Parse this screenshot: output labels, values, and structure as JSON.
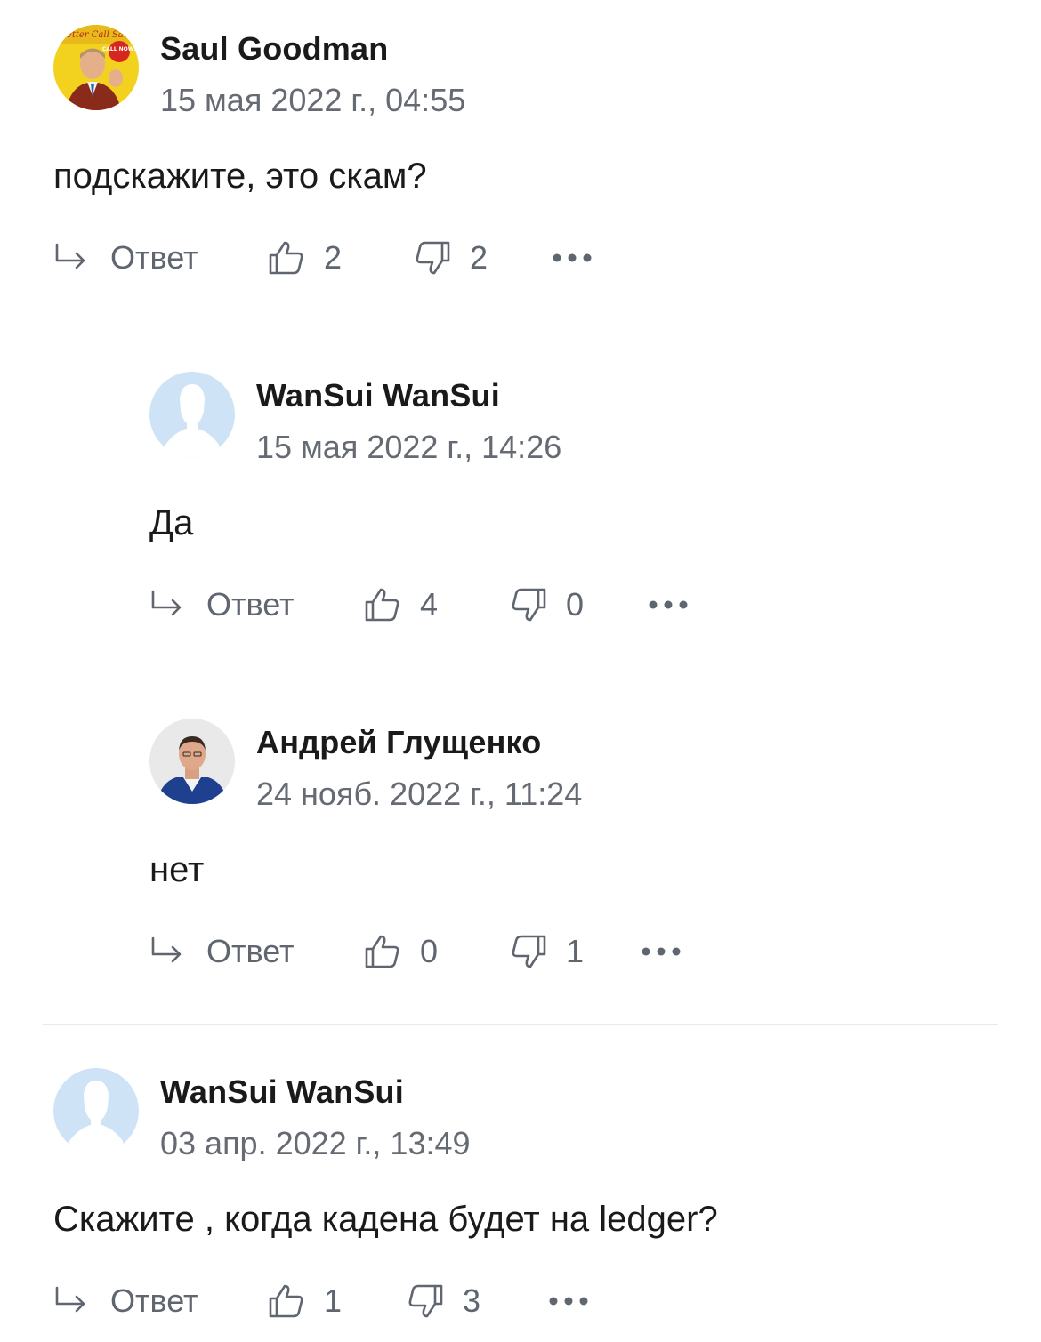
{
  "comments": [
    {
      "author": "Saul Goodman",
      "date": "15 мая 2022 г., 04:55",
      "text": "подскажите, это скам?",
      "reply_label": "Ответ",
      "likes": "2",
      "dislikes": "2",
      "avatar": "photo-avatar-saul",
      "avatar_banner_text": "Better Call Saul",
      "avatar_badge_text": "CALL NOW!"
    },
    {
      "author": "WanSui WanSui",
      "date": "15 мая 2022 г., 14:26",
      "text": "Да",
      "reply_label": "Ответ",
      "likes": "4",
      "dislikes": "0",
      "avatar": "default-person-avatar"
    },
    {
      "author": "Андрей Глущенко",
      "date": "24 нояб. 2022 г., 11:24",
      "text": "нет",
      "reply_label": "Ответ",
      "likes": "0",
      "dislikes": "1",
      "avatar": "photo-avatar-andrey"
    },
    {
      "author": "WanSui WanSui",
      "date": "03 апр. 2022 г., 13:49",
      "text": "Скажите , когда кадена будет на ledger?",
      "reply_label": "Ответ",
      "likes": "1",
      "dislikes": "3",
      "avatar": "default-person-avatar"
    }
  ],
  "icons": {
    "reply": "reply-arrow-icon",
    "like": "thumbs-up-icon",
    "dislike": "thumbs-down-icon",
    "more": "more-dots-icon"
  },
  "colors": {
    "text": "#1a1a1a",
    "muted": "#666b73",
    "action": "#5f6670",
    "default_avatar_bg": "#cfe3f7",
    "default_avatar_fg": "#ffffff",
    "divider": "#e8e9eb"
  }
}
